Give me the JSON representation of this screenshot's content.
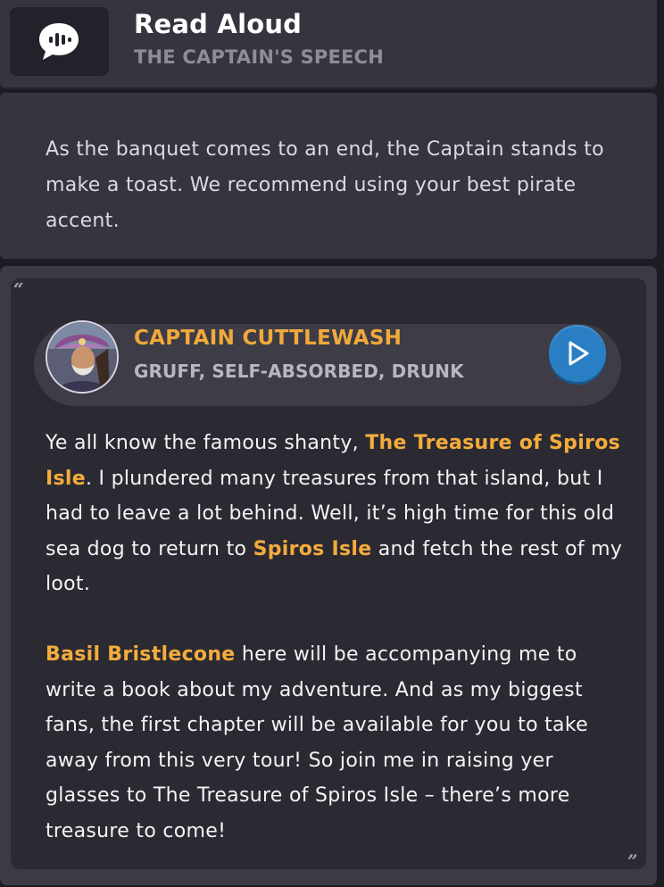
{
  "header": {
    "icon": "speech-bubble-icon",
    "title": "Read Aloud",
    "subtitle": "THE CAPTAIN'S SPEECH"
  },
  "intro": {
    "text": "As the banquet comes to an end, the Captain stands to make a toast. We recommend using your best pirate accent."
  },
  "quote": {
    "open_mark": "“",
    "close_mark": "”",
    "speaker": {
      "name": "CAPTAIN CUTTLEWASH",
      "traits": "GRUFF, SELF-ABSORBED, DRUNK",
      "avatar_icon": "captain-portrait",
      "play_icon": "play-icon"
    },
    "paragraph1": {
      "t1": "Ye all know the famous shanty, ",
      "h1": "The Treasure of Spiros Isle",
      "t2": ". I plundered many treasures from that island, but I had to leave a lot behind. Well, it’s high time for this old sea dog to return to ",
      "h2": "Spiros Isle",
      "t3": " and fetch the rest of my loot."
    },
    "paragraph2": {
      "h1": "Basil Bristlecone",
      "t1": " here will be accompanying me to write a book about my adventure. And as my biggest fans, the first chapter will be available for you to take away from this very tour! So join me in raising yer glasses to The Treasure of Spiros Isle – there’s more treasure to come!"
    }
  },
  "colors": {
    "highlight": "#f4ac3c",
    "play_button": "#2a7fc4",
    "panel": "#35343f"
  }
}
